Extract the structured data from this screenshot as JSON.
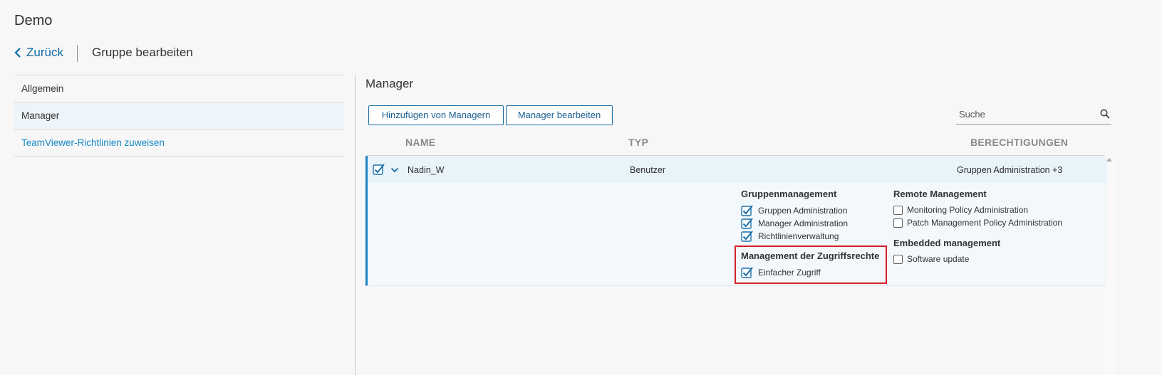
{
  "app": {
    "title": "Demo"
  },
  "nav": {
    "back_label": "Zurück",
    "page_title": "Gruppe bearbeiten"
  },
  "sidebar": {
    "items": [
      {
        "label": "Allgemein"
      },
      {
        "label": "Manager"
      },
      {
        "label": "TeamViewer-Richtlinien zuweisen"
      }
    ]
  },
  "main": {
    "section_title": "Manager",
    "buttons": {
      "add": "Hinzufügen von Managern",
      "edit": "Manager bearbeiten"
    },
    "search": {
      "placeholder": "Suche"
    },
    "columns": {
      "name": "NAME",
      "type": "TYP",
      "permissions": "BERECHTIGUNGEN"
    },
    "row": {
      "name": "Nadin_W",
      "type": "Benutzer",
      "permissions_summary": "Gruppen Administration +3",
      "checked": true
    },
    "permissions": {
      "group_mgmt": {
        "title": "Gruppenmanagement",
        "items": [
          {
            "label": "Gruppen Administration",
            "checked": true
          },
          {
            "label": "Manager Administration",
            "checked": true
          },
          {
            "label": "Richtlinienverwaltung",
            "checked": true
          }
        ]
      },
      "access_mgmt": {
        "title": "Management der Zugriffsrechte",
        "items": [
          {
            "label": "Einfacher Zugriff",
            "checked": true
          }
        ]
      },
      "remote_mgmt": {
        "title": "Remote Management",
        "items": [
          {
            "label": "Monitoring Policy Administration",
            "checked": false
          },
          {
            "label": "Patch Management Policy Administration",
            "checked": false
          }
        ]
      },
      "embedded_mgmt": {
        "title": "Embedded management",
        "items": [
          {
            "label": "Software update",
            "checked": false
          }
        ]
      }
    }
  },
  "colors": {
    "accent": "#1a83c4",
    "link": "#1589c9",
    "highlight": "#d81f26"
  },
  "icons": [
    "chevron-left-icon",
    "search-icon",
    "chevron-down-icon",
    "checkbox-checked-icon"
  ]
}
